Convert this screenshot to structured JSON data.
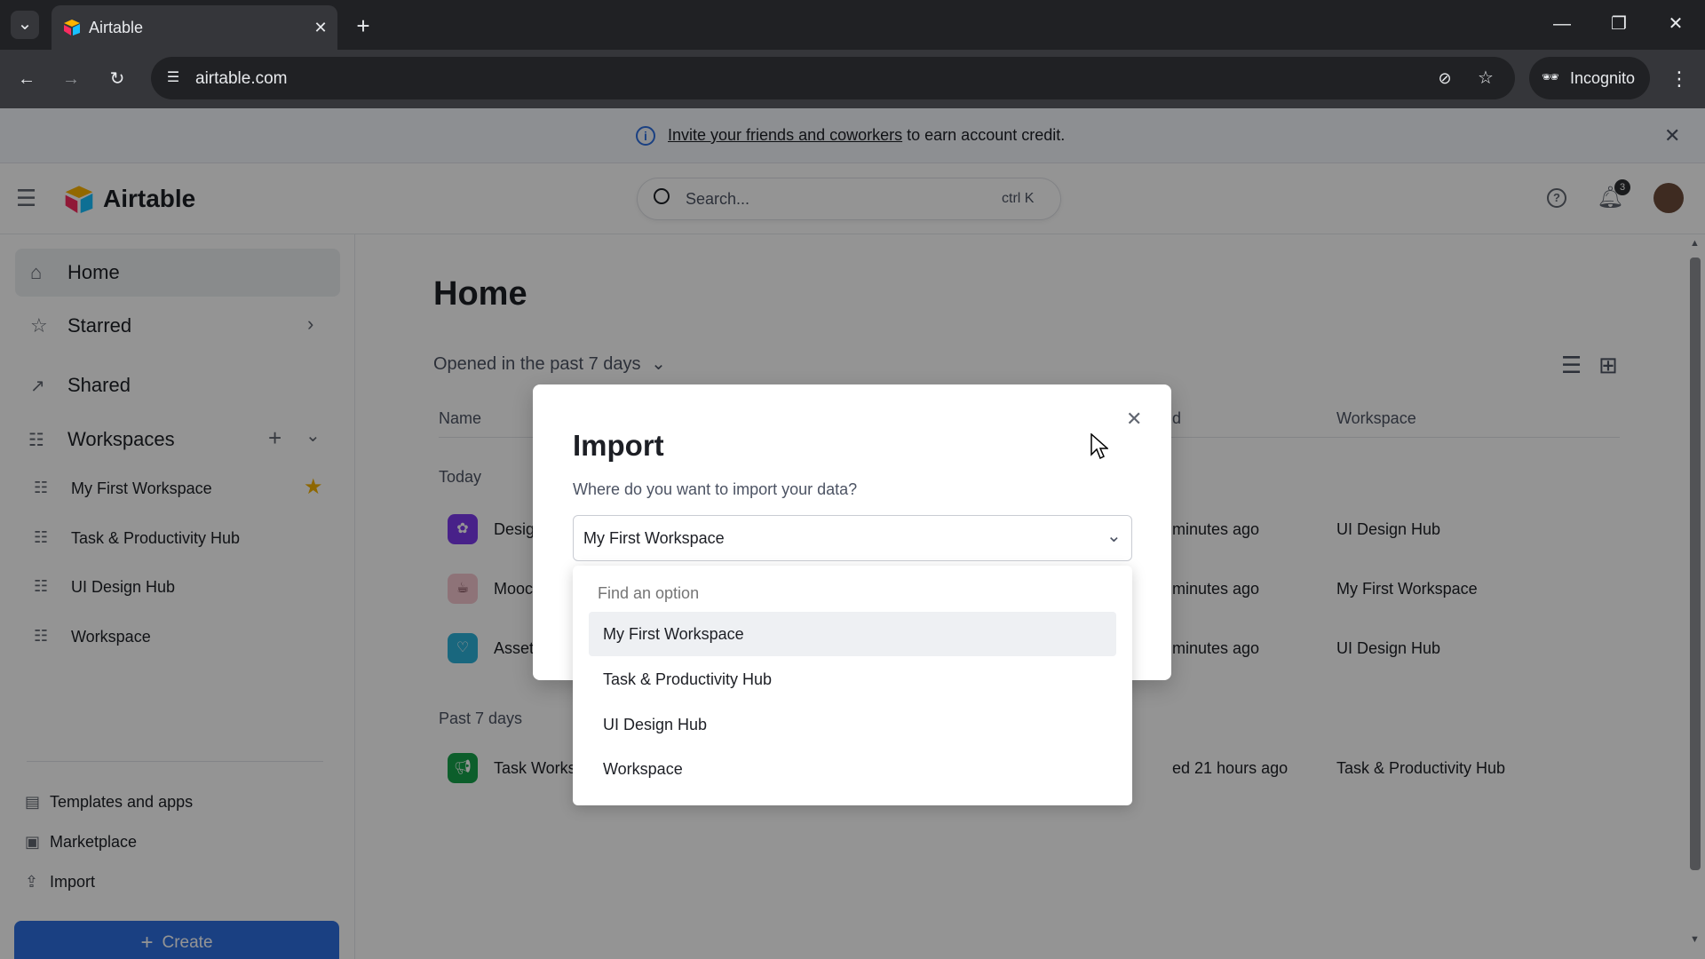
{
  "browser": {
    "tab_title": "Airtable",
    "url": "airtable.com",
    "incognito_label": "Incognito"
  },
  "banner": {
    "link_text": "Invite your friends and coworkers",
    "text": "to earn account credit."
  },
  "header": {
    "brand": "Airtable",
    "search_placeholder": "Search...",
    "search_shortcut": "ctrl K",
    "notification_count": "3"
  },
  "sidebar": {
    "home": "Home",
    "starred": "Starred",
    "shared": "Shared",
    "workspaces": "Workspaces",
    "workspace_items": [
      "My First Workspace",
      "Task & Productivity Hub",
      "UI Design Hub",
      "Workspace"
    ],
    "templates": "Templates and apps",
    "marketplace": "Marketplace",
    "import": "Import",
    "create": "Create"
  },
  "main": {
    "title": "Home",
    "filter": "Opened in the past 7 days",
    "col_name": "Name",
    "col_opened": "d",
    "col_workspace": "Workspace",
    "section_today": "Today",
    "section_past": "Past 7 days",
    "rows": [
      {
        "name": "Desig",
        "opened": "minutes ago",
        "workspace": "UI Design Hub",
        "color": "#7c3aed"
      },
      {
        "name": "Mooc",
        "opened": "minutes ago",
        "workspace": "My First Workspace",
        "color": "#f4c7cf"
      },
      {
        "name": "Asset",
        "opened": "minutes ago",
        "workspace": "UI Design Hub",
        "color": "#2bb1d9"
      },
      {
        "name": "Task Works",
        "opened": "ed 21 hours ago",
        "workspace": "Task & Productivity Hub",
        "color": "#16a34a"
      }
    ]
  },
  "modal": {
    "title": "Import",
    "question": "Where do you want to import your data?",
    "selected": "My First Workspace",
    "find_placeholder": "Find an option",
    "options": [
      "My First Workspace",
      "Task & Productivity Hub",
      "UI Design Hub",
      "Workspace"
    ]
  },
  "colors": {
    "accent": "#2d6fe0",
    "star": "#f5b100"
  }
}
